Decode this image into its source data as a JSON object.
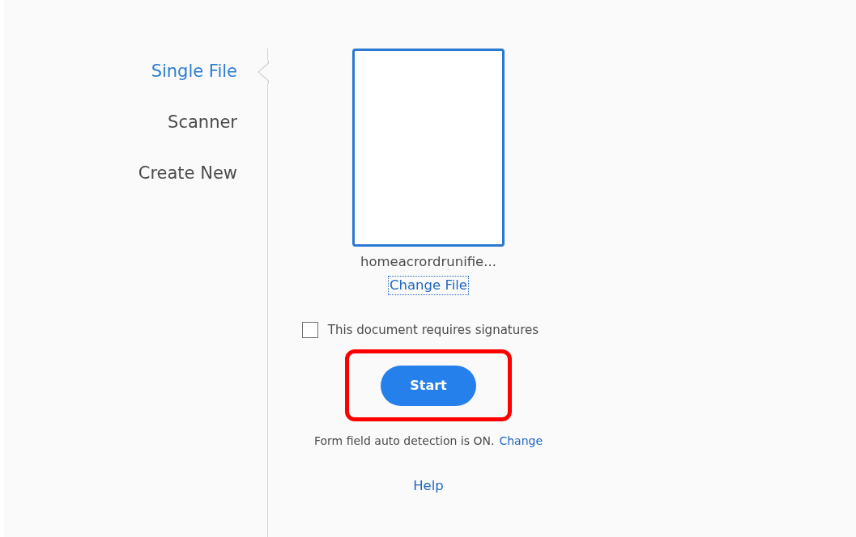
{
  "sidebar": {
    "items": [
      {
        "label": "Single File",
        "selected": true
      },
      {
        "label": "Scanner",
        "selected": false
      },
      {
        "label": "Create New",
        "selected": false
      }
    ]
  },
  "file": {
    "name": "homeacrordrunifie...",
    "change_link": "Change File"
  },
  "signature_checkbox": {
    "label": "This document requires signatures",
    "checked": false
  },
  "start_button": {
    "label": "Start",
    "highlighted": true
  },
  "detection": {
    "text": "Form field auto detection is ON.",
    "link": "Change"
  },
  "help_link": "Help"
}
